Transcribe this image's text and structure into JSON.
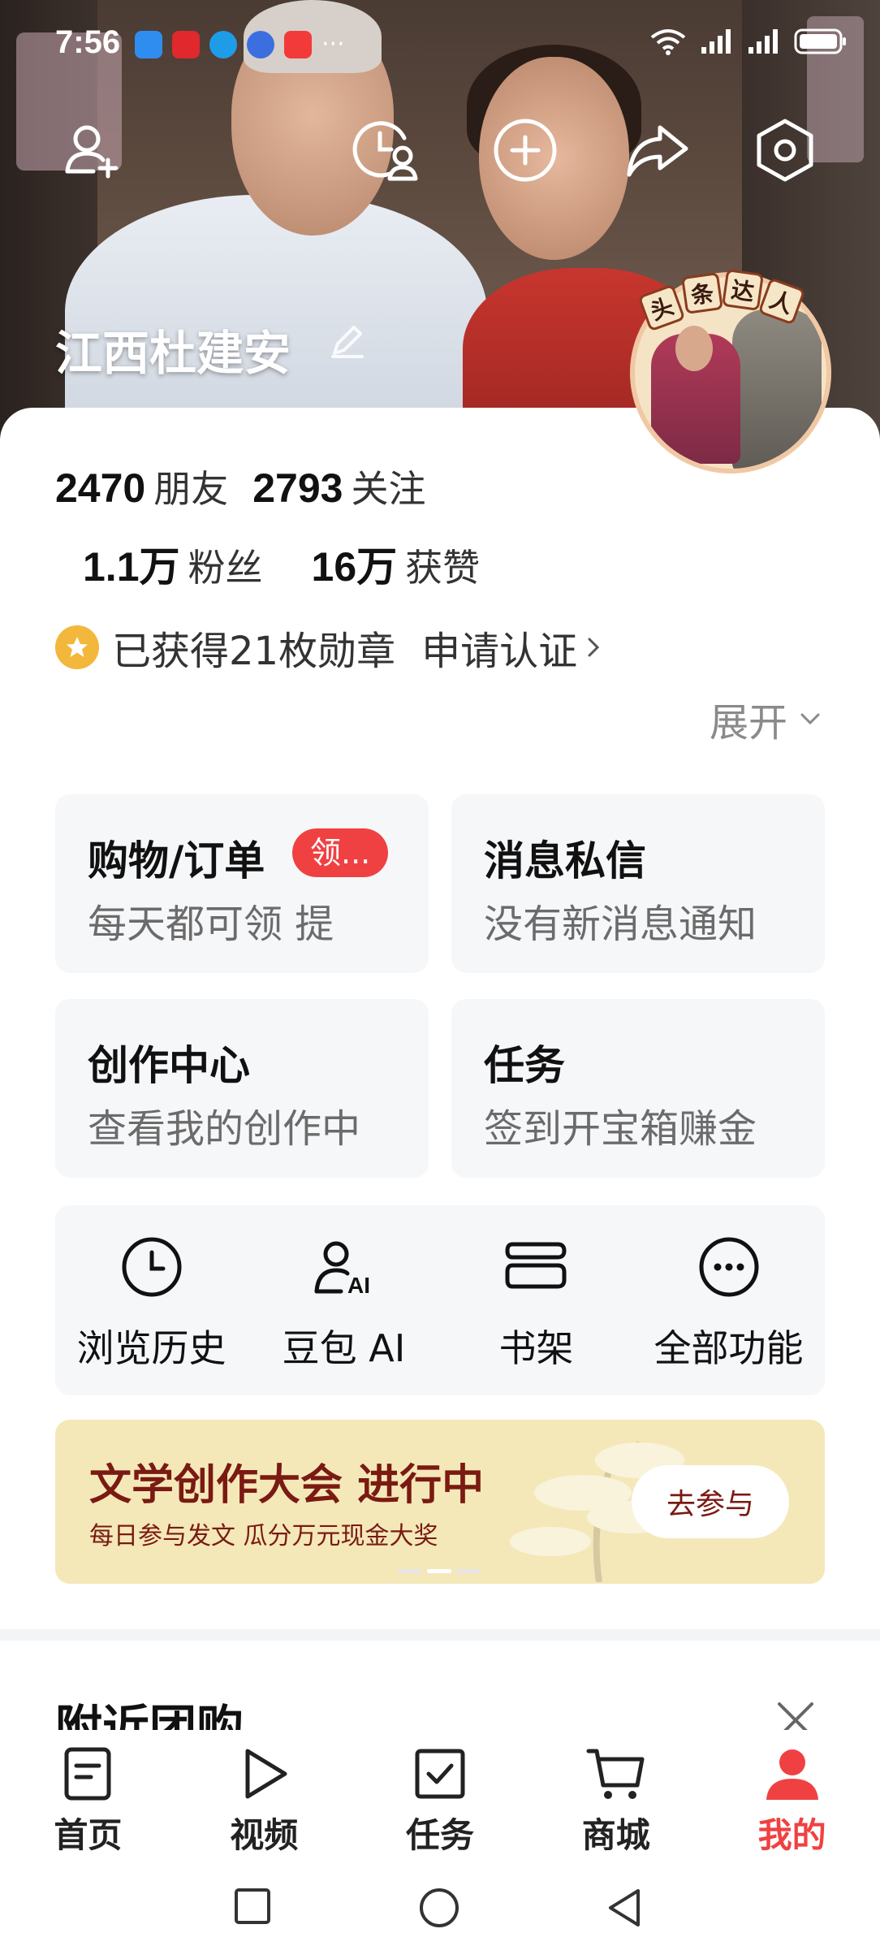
{
  "status_bar": {
    "time": "7:56",
    "more": "···"
  },
  "header": {
    "profile_name": "江西杜建安"
  },
  "avatar": {
    "badge_chars": [
      "头",
      "条",
      "达",
      "人"
    ]
  },
  "stats": {
    "friends_count": "2470",
    "friends_label": "朋友",
    "following_count": "2793",
    "following_label": "关注",
    "followers_count": "1.1万",
    "followers_label": "粉丝",
    "likes_count": "16万",
    "likes_label": "获赞"
  },
  "medals": {
    "text": "已获得21枚勋章",
    "verify": "申请认证"
  },
  "expand_label": "展开",
  "tiles": [
    {
      "title": "购物/订单",
      "badge": "领...",
      "sub": "每天都可领 提"
    },
    {
      "title": "消息私信",
      "sub": "没有新消息通知"
    },
    {
      "title": "创作中心",
      "sub": "查看我的创作中"
    },
    {
      "title": "任务",
      "sub": "签到开宝箱赚金"
    }
  ],
  "quick": [
    {
      "label": "浏览历史",
      "icon": "clock-icon"
    },
    {
      "label": "豆包 AI",
      "icon": "ai-user-icon"
    },
    {
      "label": "书架",
      "icon": "bookshelf-icon"
    },
    {
      "label": "全部功能",
      "icon": "more-icon"
    }
  ],
  "promo": {
    "title": "文学创作大会 进行中",
    "sub": "每日参与发文 瓜分万元现金大奖",
    "button": "去参与"
  },
  "section": {
    "title": "附近团购"
  },
  "bottom_nav": [
    {
      "label": "首页",
      "icon": "home-icon"
    },
    {
      "label": "视频",
      "icon": "play-icon"
    },
    {
      "label": "任务",
      "icon": "task-icon"
    },
    {
      "label": "商城",
      "icon": "cart-icon"
    },
    {
      "label": "我的",
      "icon": "profile-icon",
      "active": true
    }
  ],
  "colors": {
    "accent": "#f04142",
    "promo_bg": "#f4e8b9",
    "promo_text": "#7a1a12",
    "tile_bg": "#f6f7f9"
  }
}
